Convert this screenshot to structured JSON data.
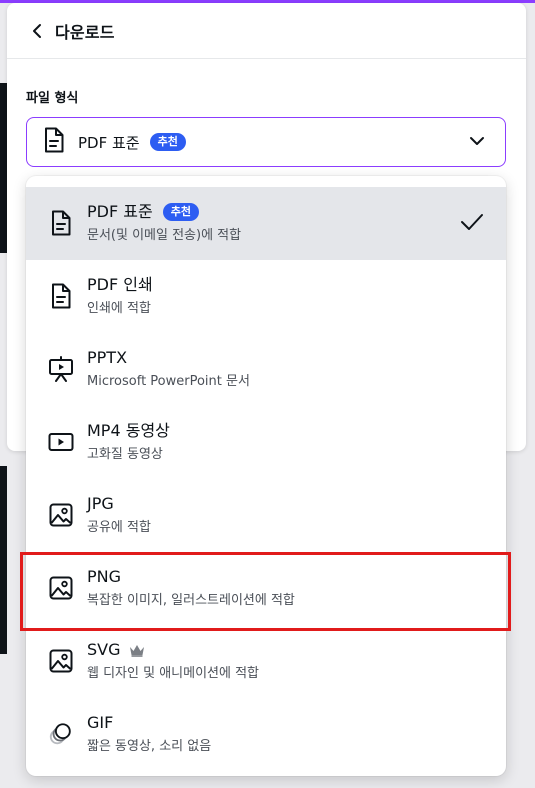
{
  "panel": {
    "title": "다운로드",
    "file_type_label": "파일 형식"
  },
  "select": {
    "value": "PDF 표준",
    "badge": "추천"
  },
  "options": [
    {
      "label": "PDF 표준",
      "badge": "추천",
      "desc": "문서(및 이메일 전송)에 적합",
      "icon": "document-icon",
      "selected": true
    },
    {
      "label": "PDF 인쇄",
      "desc": "인쇄에 적합",
      "icon": "document-icon"
    },
    {
      "label": "PPTX",
      "desc": "Microsoft PowerPoint 문서",
      "icon": "presentation-icon"
    },
    {
      "label": "MP4 동영상",
      "desc": "고화질 동영상",
      "icon": "video-icon"
    },
    {
      "label": "JPG",
      "desc": "공유에 적합",
      "icon": "image-icon"
    },
    {
      "label": "PNG",
      "desc": "복잡한 이미지, 일러스트레이션에 적합",
      "icon": "image-icon",
      "highlighted": true
    },
    {
      "label": "SVG",
      "desc": "웹 디자인 및 애니메이션에 적합",
      "icon": "image-icon",
      "premium": true
    },
    {
      "label": "GIF",
      "desc": "짧은 동영상, 소리 없음",
      "icon": "gif-icon"
    }
  ],
  "colors": {
    "accent": "#8b3dff",
    "badge": "#2d5df2",
    "highlight_box": "#e11b1b",
    "selected_bg": "#e4e6ea"
  }
}
